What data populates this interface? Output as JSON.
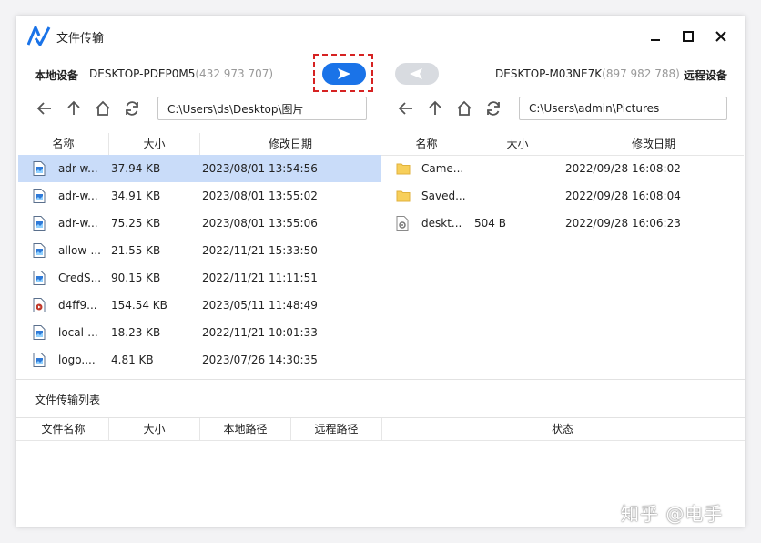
{
  "window": {
    "title": "文件传输"
  },
  "devices": {
    "local_label": "本地设备",
    "local_name": "DESKTOP-PDEP0M5",
    "local_id": "(432 973 707)",
    "remote_name": "DESKTOP-M03NE7K",
    "remote_id": "(897 982 788)",
    "remote_label": "远程设备",
    "send_icon": "send-arrow-right",
    "receive_icon": "receive-arrow-left"
  },
  "local": {
    "path": "C:\\Users\\ds\\Desktop\\图片",
    "columns": [
      "名称",
      "大小",
      "修改日期"
    ],
    "files": [
      {
        "name": "adr-w...",
        "size": "37.94 KB",
        "date": "2023/08/01 13:54:56",
        "icon": "image-file-icon",
        "selected": true
      },
      {
        "name": "adr-w...",
        "size": "34.91 KB",
        "date": "2023/08/01 13:55:02",
        "icon": "image-file-icon",
        "selected": false
      },
      {
        "name": "adr-w...",
        "size": "75.25 KB",
        "date": "2023/08/01 13:55:06",
        "icon": "image-file-icon",
        "selected": false
      },
      {
        "name": "allow-...",
        "size": "21.55 KB",
        "date": "2022/11/21 15:33:50",
        "icon": "image-file-icon",
        "selected": false
      },
      {
        "name": "CredS...",
        "size": "90.15 KB",
        "date": "2022/11/21 11:11:51",
        "icon": "image-file-icon",
        "selected": false
      },
      {
        "name": "d4ff9...",
        "size": "154.54 KB",
        "date": "2023/05/11 11:48:49",
        "icon": "video-file-icon",
        "selected": false
      },
      {
        "name": "local-...",
        "size": "18.23 KB",
        "date": "2022/11/21 10:01:33",
        "icon": "image-file-icon",
        "selected": false
      },
      {
        "name": "logo....",
        "size": "4.81 KB",
        "date": "2023/07/26 14:30:35",
        "icon": "image-file-icon",
        "selected": false
      }
    ]
  },
  "remote": {
    "path": "C:\\Users\\admin\\Pictures",
    "columns": [
      "名称",
      "大小",
      "修改日期"
    ],
    "files": [
      {
        "name": "Came...",
        "size": "",
        "date": "2022/09/28 16:08:02",
        "icon": "folder-icon"
      },
      {
        "name": "Saved...",
        "size": "",
        "date": "2022/09/28 16:08:04",
        "icon": "folder-icon"
      },
      {
        "name": "deskt...",
        "size": "504 B",
        "date": "2022/09/28 16:06:23",
        "icon": "settings-file-icon"
      }
    ]
  },
  "transfer": {
    "title": "文件传输列表",
    "columns": [
      "文件名称",
      "大小",
      "本地路径",
      "远程路径",
      "状态"
    ]
  },
  "watermark": "知乎 @电手",
  "colors": {
    "accent": "#1a73e8",
    "selected_row": "#c9dcf9",
    "highlight_border": "#d62222"
  }
}
